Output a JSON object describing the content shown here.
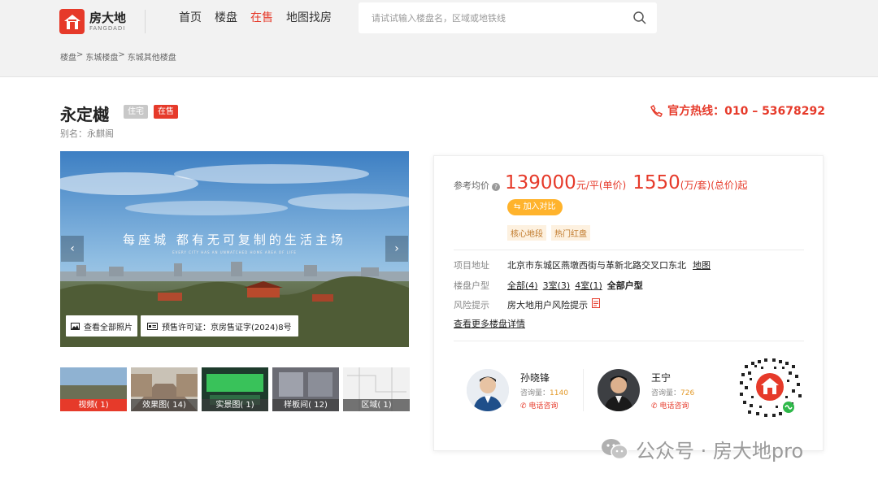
{
  "header": {
    "logo_cn": "房大地",
    "logo_en": "FANGDADI",
    "nav": [
      {
        "label": "首页",
        "active": false
      },
      {
        "label": "楼盘",
        "active": false
      },
      {
        "label": "在售",
        "active": true
      },
      {
        "label": "地图找房",
        "active": false
      }
    ],
    "search_placeholder": "请试试输入楼盘名，区域或地铁线"
  },
  "breadcrumb": [
    "楼盘",
    ">",
    "东城楼盘",
    ">",
    "东城其他楼盘"
  ],
  "project": {
    "title": "永定樾",
    "tag_type": "住宅",
    "tag_status": "在售",
    "alias": "别名：永麒阁",
    "hotline": "官方热线：010 – 53678292"
  },
  "gallery": {
    "slogan": "每座城 都有无可复制的生活主场",
    "slogan_sub": "EVERY CITY HAS AN UNMATCHED HOME AREA OF LIFE",
    "arrow_left": "‹",
    "arrow_right": "›",
    "view_all": "查看全部照片",
    "permit": "预售许可证：京房售证字(2024)8号",
    "thumbs": [
      {
        "label": "视频( 1)",
        "active": true
      },
      {
        "label": "效果图( 14)",
        "active": false
      },
      {
        "label": "实景图( 1)",
        "active": false
      },
      {
        "label": "样板间( 12)",
        "active": false
      },
      {
        "label": "区域( 1)",
        "active": false
      }
    ]
  },
  "card": {
    "price_label": "参考均价",
    "price_help": "?",
    "price_unit_value": "139000",
    "price_unit_suffix": "元/平(单价)",
    "price_total_value": "1550",
    "price_total_suffix": "(万/套)(总价)起",
    "compare_label": "加入对比",
    "feature_tags": [
      "核心地段",
      "热门红盘"
    ],
    "address_label": "项目地址",
    "address_value": "北京市东城区燕墩西街与革新北路交叉口东北",
    "map_link": "地图",
    "layout_label": "楼盘户型",
    "layouts": [
      "全部(4)",
      "3室(3)",
      "4室(1)"
    ],
    "layouts_all": "全部户型",
    "risk_label": "风险提示",
    "risk_value": "房大地用户风险提示",
    "more_link": "查看更多楼盘详情",
    "agents": [
      {
        "name": "孙晓锋",
        "count_label": "咨询量：",
        "count": "1140",
        "call": "电话咨询"
      },
      {
        "name": "王宁",
        "count_label": "咨询量：",
        "count": "726",
        "call": "电话咨询"
      }
    ]
  },
  "watermark": "公众号 · 房大地pro",
  "colors": {
    "accent": "#e63a2a",
    "compare": "#ffb32c"
  }
}
